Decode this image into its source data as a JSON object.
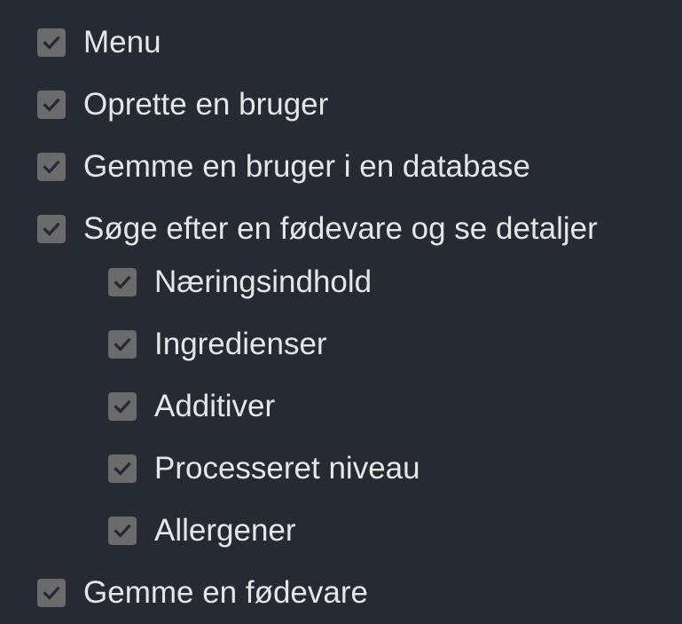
{
  "task_list": {
    "items": [
      {
        "label": "Menu",
        "checked": true,
        "level": 0
      },
      {
        "label": "Oprette en bruger",
        "checked": true,
        "level": 0
      },
      {
        "label": "Gemme en bruger i en database",
        "checked": true,
        "level": 0
      },
      {
        "label": "Søge efter en fødevare og se detaljer",
        "checked": true,
        "level": 0
      },
      {
        "label": "Næringsindhold",
        "checked": true,
        "level": 1
      },
      {
        "label": "Ingredienser",
        "checked": true,
        "level": 1
      },
      {
        "label": "Additiver",
        "checked": true,
        "level": 1
      },
      {
        "label": "Processeret niveau",
        "checked": true,
        "level": 1
      },
      {
        "label": "Allergener",
        "checked": true,
        "level": 1
      },
      {
        "label": "Gemme en fødevare",
        "checked": true,
        "level": 0
      }
    ]
  },
  "colors": {
    "background": "#262a33",
    "text": "#e6e6e6",
    "checkbox_fill": "#6b6b6b",
    "checkmark": "#262a33"
  },
  "icons": {
    "checkbox": "checked-checkbox-icon"
  }
}
